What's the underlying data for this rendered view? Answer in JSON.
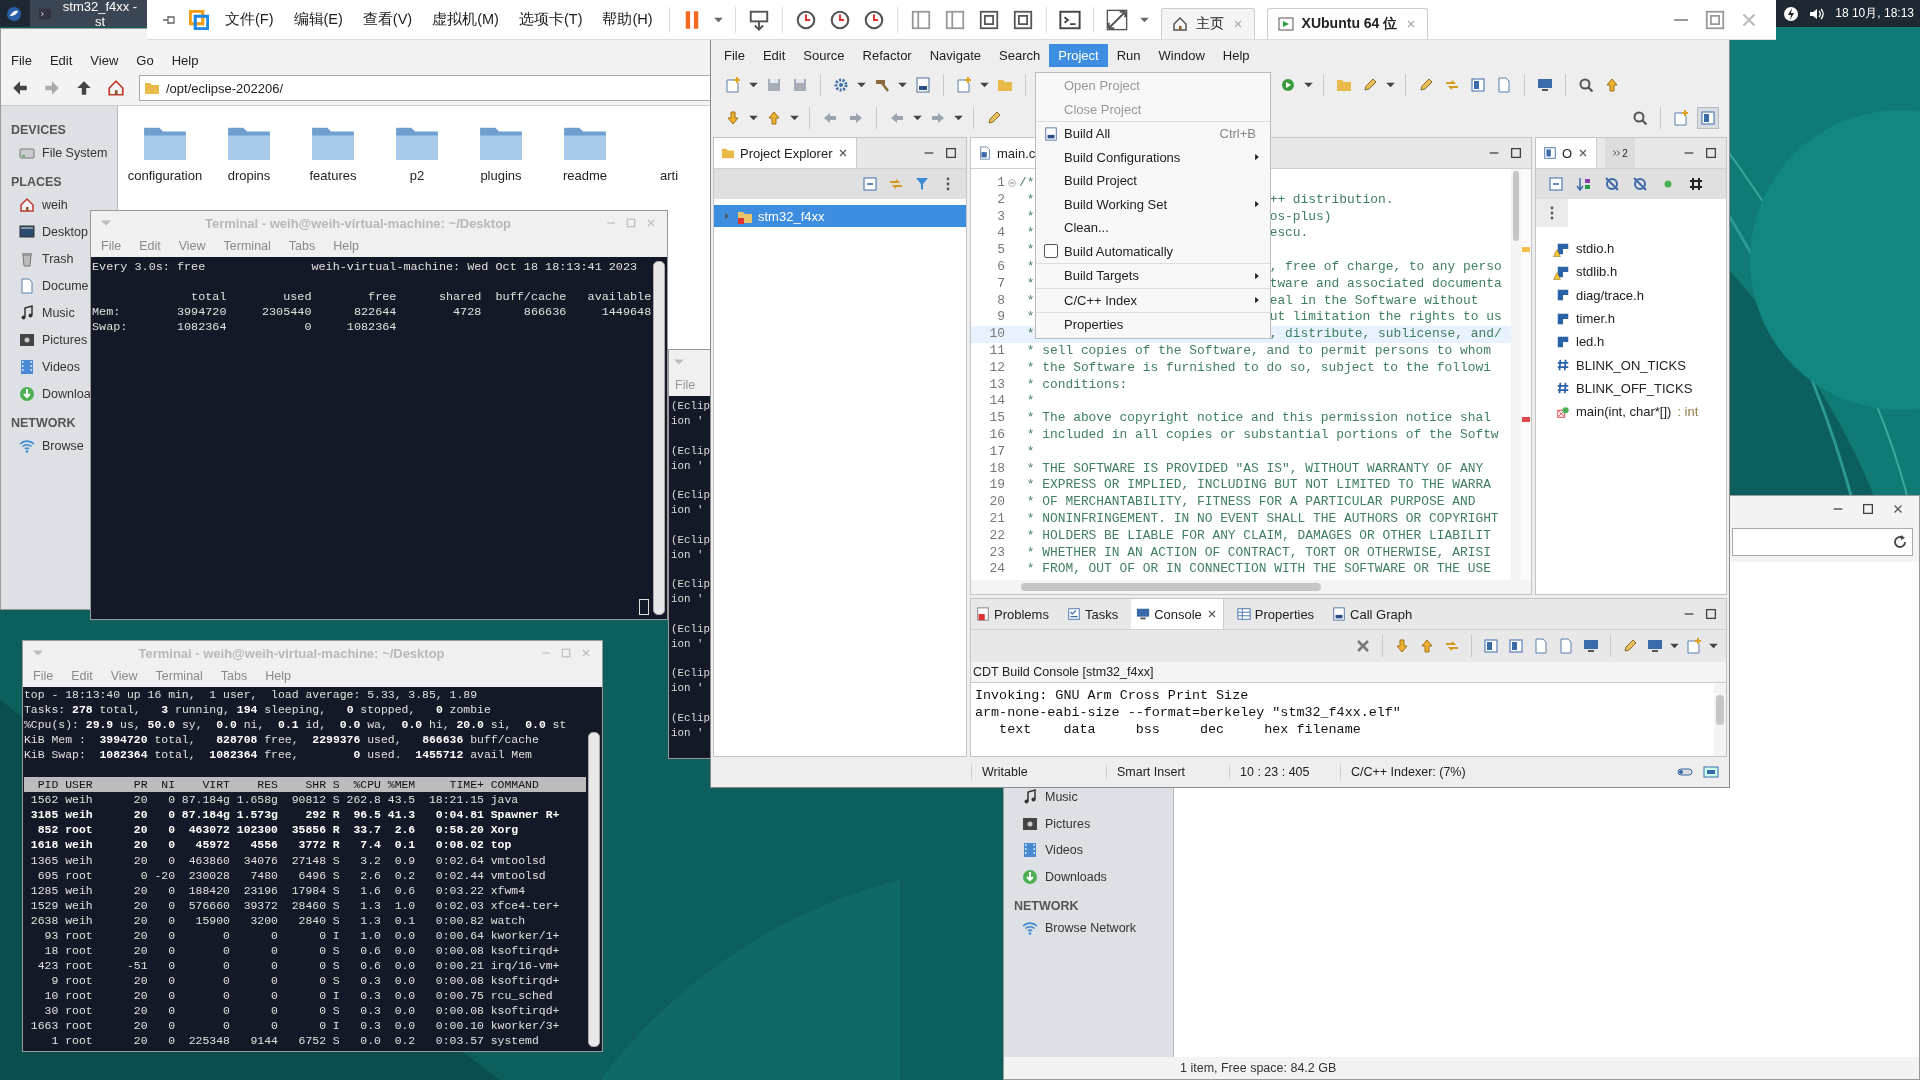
{
  "top_panel": {
    "taskbar_item": "stm32_f4xx - st",
    "clock": "18 10月, 18:13"
  },
  "vmware": {
    "menu": [
      "文件(F)",
      "编辑(E)",
      "查看(V)",
      "虚拟机(M)",
      "选项卡(T)",
      "帮助(H)"
    ],
    "tabs": [
      {
        "label": "主页",
        "kind": "home",
        "selected": false
      },
      {
        "label": "XUbuntu 64 位",
        "kind": "vm",
        "selected": true
      }
    ]
  },
  "file_manager": {
    "menu": [
      "File",
      "Edit",
      "View",
      "Go",
      "Help"
    ],
    "path": "/opt/eclipse-202206/",
    "sidebar": [
      {
        "kind": "heading",
        "label": "DEVICES"
      },
      {
        "kind": "item",
        "label": "File System"
      },
      {
        "kind": "heading",
        "label": "PLACES"
      },
      {
        "kind": "item",
        "label": "weih"
      },
      {
        "kind": "item",
        "label": "Desktop"
      },
      {
        "kind": "item",
        "label": "Trash"
      },
      {
        "kind": "item",
        "label": "Docume"
      },
      {
        "kind": "item",
        "label": "Music"
      },
      {
        "kind": "item",
        "label": "Pictures"
      },
      {
        "kind": "item",
        "label": "Videos"
      },
      {
        "kind": "item",
        "label": "Downloa"
      },
      {
        "kind": "heading",
        "label": "NETWORK"
      },
      {
        "kind": "item",
        "label": "Browse"
      }
    ],
    "folders": [
      {
        "label": "configuration",
        "kind": "folder"
      },
      {
        "label": "dropins",
        "kind": "folder"
      },
      {
        "label": "features",
        "kind": "folder"
      },
      {
        "label": "p2",
        "kind": "folder"
      },
      {
        "label": "plugins",
        "kind": "folder"
      },
      {
        "label": "readme",
        "kind": "folder"
      },
      {
        "label": "arti",
        "kind": "file"
      }
    ]
  },
  "file_manager_2": {
    "sidebar": [
      {
        "kind": "item",
        "label": "Music"
      },
      {
        "kind": "item",
        "label": "Pictures"
      },
      {
        "kind": "item",
        "label": "Videos"
      },
      {
        "kind": "item",
        "label": "Downloads"
      },
      {
        "kind": "heading",
        "label": "NETWORK"
      },
      {
        "kind": "item",
        "label": "Browse Network"
      }
    ],
    "status": "1 item, Free space: 84.2 GB"
  },
  "terminal_log": {
    "menu": [
      "File"
    ],
    "lines": [
      "(Eclip",
      "ion '",
      "(Eclip",
      "ion '",
      "(Eclip",
      "ion '",
      "(Eclip",
      "ion '",
      "(Eclip",
      "ion '",
      "(Eclip",
      "ion '",
      "(Eclip",
      "ion '",
      "(Eclip",
      "ion '"
    ]
  },
  "eclipse": {
    "menu": [
      {
        "label": "File",
        "selected": false
      },
      {
        "label": "Edit",
        "selected": false
      },
      {
        "label": "Source",
        "selected": false
      },
      {
        "label": "Refactor",
        "selected": false
      },
      {
        "label": "Navigate",
        "selected": false
      },
      {
        "label": "Search",
        "selected": false
      },
      {
        "label": "Project",
        "selected": true
      },
      {
        "label": "Run",
        "selected": false
      },
      {
        "label": "Window",
        "selected": false
      },
      {
        "label": "Help",
        "selected": false
      }
    ],
    "project_menu": [
      {
        "label": "Open Project",
        "kind": "item",
        "disabled": true,
        "separator_before": false
      },
      {
        "label": "Close Project",
        "kind": "item",
        "disabled": true,
        "separator_before": false
      },
      {
        "label": "Build All",
        "kind": "item",
        "disabled": false,
        "shortcut": "Ctrl+B",
        "separator_before": true
      },
      {
        "label": "Build Configurations",
        "kind": "submenu",
        "disabled": false,
        "separator_before": false
      },
      {
        "label": "Build Project",
        "kind": "item",
        "disabled": false,
        "separator_before": false
      },
      {
        "label": "Build Working Set",
        "kind": "submenu",
        "disabled": false,
        "separator_before": false
      },
      {
        "label": "Clean...",
        "kind": "item",
        "disabled": false,
        "separator_before": false
      },
      {
        "label": "Build Automatically",
        "kind": "checkbox",
        "checked": false,
        "disabled": false,
        "separator_before": false
      },
      {
        "label": "Build Targets",
        "kind": "submenu",
        "disabled": false,
        "separator_before": true
      },
      {
        "label": "C/C++ Index",
        "kind": "submenu",
        "disabled": false,
        "separator_before": true
      },
      {
        "label": "Properties",
        "kind": "item",
        "disabled": false,
        "separator_before": true
      }
    ],
    "project_explorer": {
      "tab": "Project Explorer",
      "tree": [
        {
          "label": "stm32_f4xx",
          "selected": true,
          "expanded": false
        }
      ]
    },
    "editor": {
      "tab": "main.c",
      "lines": [
        {
          "no": "1",
          "text": "/*",
          "current": false
        },
        {
          "no": "2",
          "text": " *",
          "rest": "++ distribution.",
          "current": false
        },
        {
          "no": "3",
          "text": " *",
          "rest": "os-plus)",
          "current": false
        },
        {
          "no": "4",
          "text": " *",
          "rest": "escu.",
          "current": false
        },
        {
          "no": "5",
          "text": " *",
          "current": false
        },
        {
          "no": "6",
          "text": " *",
          "rest": ", free of charge, to any perso",
          "current": false
        },
        {
          "no": "7",
          "text": " *",
          "rest": "tware and associated documenta",
          "current": false
        },
        {
          "no": "8",
          "text": " *",
          "rest": "eal in the Software without",
          "current": false
        },
        {
          "no": "9",
          "text": " *",
          "rest": "ut limitation the rights to us",
          "current": false
        },
        {
          "no": "10",
          "text": " *",
          "rest": ", distribute, sublicense, and/",
          "current": true
        },
        {
          "no": "11",
          "text": " * sell copies of the Software, and to permit persons to whom",
          "current": false
        },
        {
          "no": "12",
          "text": " * the Software is furnished to do so, subject to the followi",
          "current": false
        },
        {
          "no": "13",
          "text": " * conditions:",
          "current": false
        },
        {
          "no": "14",
          "text": " *",
          "current": false
        },
        {
          "no": "15",
          "text": " * The above copyright notice and this permission notice shal",
          "current": false
        },
        {
          "no": "16",
          "text": " * included in all copies or substantial portions of the Softw",
          "current": false
        },
        {
          "no": "17",
          "text": " *",
          "current": false
        },
        {
          "no": "18",
          "text": " * THE SOFTWARE IS PROVIDED \"AS IS\", WITHOUT WARRANTY OF ANY",
          "current": false
        },
        {
          "no": "19",
          "text": " * EXPRESS OR IMPLIED, INCLUDING BUT NOT LIMITED TO THE WARRA",
          "current": false
        },
        {
          "no": "20",
          "text": " * OF MERCHANTABILITY, FITNESS FOR A PARTICULAR PURPOSE AND",
          "current": false
        },
        {
          "no": "21",
          "text": " * NONINFRINGEMENT. IN NO EVENT SHALL THE AUTHORS OR COPYRIGHT",
          "current": false
        },
        {
          "no": "22",
          "text": " * HOLDERS BE LIABLE FOR ANY CLAIM, DAMAGES OR OTHER LIABILIT",
          "current": false
        },
        {
          "no": "23",
          "text": " * WHETHER IN AN ACTION OF CONTRACT, TORT OR OTHERWISE, ARISI",
          "current": false
        },
        {
          "no": "24",
          "text": " * FROM, OUT OF OR IN CONNECTION WITH THE SOFTWARE OR THE USE",
          "current": false
        }
      ]
    },
    "outline": {
      "tab": "O",
      "overflow_count": "2",
      "items": [
        {
          "label": "stdio.h",
          "kind": "include",
          "warning": true
        },
        {
          "label": "stdlib.h",
          "kind": "include",
          "warning": true
        },
        {
          "label": "diag/trace.h",
          "kind": "include",
          "warning": false
        },
        {
          "label": "timer.h",
          "kind": "include",
          "warning": false
        },
        {
          "label": "led.h",
          "kind": "include",
          "warning": false
        },
        {
          "label": "BLINK_ON_TICKS",
          "kind": "macro",
          "warning": false
        },
        {
          "label": "BLINK_OFF_TICKS",
          "kind": "macro",
          "warning": false
        },
        {
          "label": "main(int, char*[])",
          "return_type": ": int",
          "kind": "function",
          "warning": false
        }
      ]
    },
    "console": {
      "tabs": [
        {
          "label": "Problems",
          "selected": false
        },
        {
          "label": "Tasks",
          "selected": false
        },
        {
          "label": "Console",
          "selected": true
        },
        {
          "label": "Properties",
          "selected": false
        },
        {
          "label": "Call Graph",
          "selected": false
        }
      ],
      "title": "CDT Build Console [stm32_f4xx]",
      "lines": [
        "Invoking: GNU Arm Cross Print Size",
        "arm-none-eabi-size --format=berkeley \"stm32_f4xx.elf\"",
        "   text    data     bss     dec     hex filename"
      ]
    },
    "status_bar": [
      "Writable",
      "Smart Insert",
      "10 : 23 : 405",
      "C/C++ Indexer: (7%)"
    ]
  },
  "terminal_free": {
    "title": "Terminal - weih@weih-virtual-machine: ~/Desktop",
    "menu": [
      "File",
      "Edit",
      "View",
      "Terminal",
      "Tabs",
      "Help"
    ],
    "header": "Every 3.0s: free               weih-virtual-machine: Wed Oct 18 18:13:41 2023",
    "lines": [
      "              total        used        free      shared  buff/cache   available",
      "Mem:        3994720     2305440      822644        4728      866636     1449648",
      "Swap:       1082364           0     1082364"
    ]
  },
  "terminal_top": {
    "title": "Terminal - weih@weih-virtual-machine: ~/Desktop",
    "menu": [
      "File",
      "Edit",
      "View",
      "Terminal",
      "Tabs",
      "Help"
    ],
    "summary": [
      "top - 18:13:40 up 16 min,  1 user,  load average: 5.33, 3.85, 1.89",
      "Tasks: **278** total,   **3** running, **194** sleeping,   **0** stopped,   **0** zombie",
      "%Cpu(s): **29.9** us, **50.0** sy,  **0.0** ni,  **0.1** id,  **0.0** wa,  **0.0** hi, **20.0** si,  **0.0** st",
      "KiB Mem :  **3994720** total,   **828708** free,  **2299376** used,   **866636** buff/cache",
      "KiB Swap:  **1082364** total,  **1082364** free,        **0** used.  **1455712** avail Mem"
    ],
    "table_header": "  PID USER      PR  NI    VIRT    RES    SHR S  %CPU %MEM     TIME+ COMMAND",
    "rows": [
      {
        "text": " 1562 weih      20   0 87.184g 1.658g  90812 S 262.8 43.5  18:21.15 java",
        "highlighted": false
      },
      {
        "text": " 3185 weih      20   0 87.184g 1.573g    292 R  96.5 41.3   0:04.81 Spawner R+",
        "highlighted": true
      },
      {
        "text": "  852 root      20   0  463072 102300  35856 R  33.7  2.6   0:58.20 Xorg",
        "highlighted": true
      },
      {
        "text": " 1618 weih      20   0   45972   4556   3772 R   7.4  0.1   0:08.02 top",
        "highlighted": true
      },
      {
        "text": " 1365 weih      20   0  463860  34076  27148 S   3.2  0.9   0:02.64 vmtoolsd",
        "highlighted": false
      },
      {
        "text": "  695 root       0 -20  230028   7480   6496 S   2.6  0.2   0:02.44 vmtoolsd",
        "highlighted": false
      },
      {
        "text": " 1285 weih      20   0  188420  23196  17984 S   1.6  0.6   0:03.22 xfwm4",
        "highlighted": false
      },
      {
        "text": " 1529 weih      20   0  576660  39372  28460 S   1.3  1.0   0:02.03 xfce4-ter+",
        "highlighted": false
      },
      {
        "text": " 2638 weih      20   0   15900   3200   2840 S   1.3  0.1   0:00.82 watch",
        "highlighted": false
      },
      {
        "text": "   93 root      20   0       0      0      0 I   1.0  0.0   0:00.64 kworker/1+",
        "highlighted": false
      },
      {
        "text": "   18 root      20   0       0      0      0 S   0.6  0.0   0:00.08 ksoftirqd+",
        "highlighted": false
      },
      {
        "text": "  423 root     -51   0       0      0      0 S   0.6  0.0   0:00.21 irq/16-vm+",
        "highlighted": false
      },
      {
        "text": "    9 root      20   0       0      0      0 S   0.3  0.0   0:00.08 ksoftirqd+",
        "highlighted": false
      },
      {
        "text": "   10 root      20   0       0      0      0 I   0.3  0.0   0:00.75 rcu_sched",
        "highlighted": false
      },
      {
        "text": "   30 root      20   0       0      0      0 S   0.3  0.0   0:00.08 ksoftirqd+",
        "highlighted": false
      },
      {
        "text": " 1663 root      20   0       0      0      0 I   0.3  0.0   0:00.10 kworker/3+",
        "highlighted": false
      },
      {
        "text": "    1 root      20   0  225348   9144   6752 S   0.0  0.2   0:03.57 systemd",
        "highlighted": false
      }
    ]
  }
}
